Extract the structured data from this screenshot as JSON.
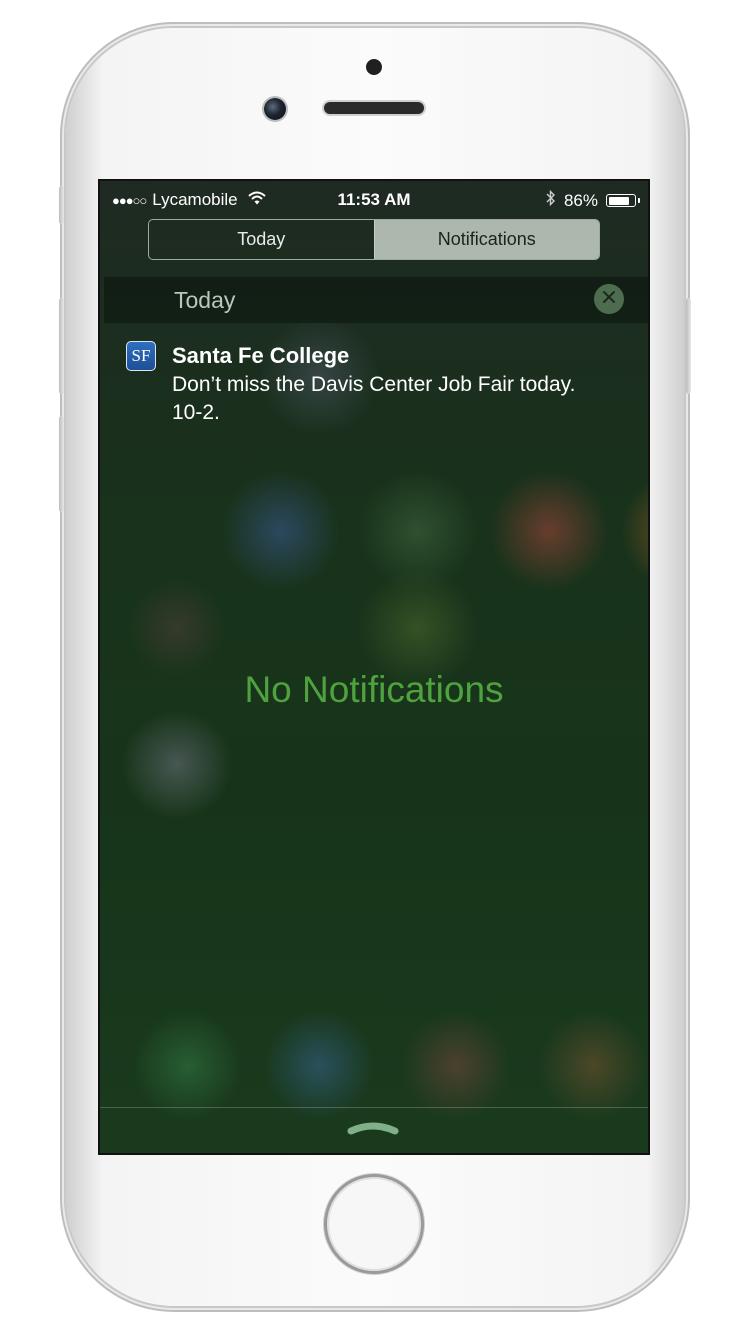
{
  "status_bar": {
    "signal_dots": "●●●○○",
    "carrier": "Lycamobile",
    "time": "11:53 AM",
    "battery_percent": "86%",
    "battery_level": 0.86,
    "icons": [
      "signal-dots-icon",
      "wifi-icon",
      "bluetooth-icon",
      "battery-icon"
    ]
  },
  "tabs": [
    {
      "label": "Today",
      "selected": false
    },
    {
      "label": "Notifications",
      "selected": true
    }
  ],
  "section": {
    "title": "Today",
    "clear_icon": "close-icon"
  },
  "notification": {
    "app_icon_text": "SF",
    "title": "Santa Fe College",
    "body": "Don’t miss the Davis Center Job Fair today. 10-2."
  },
  "empty_state": "No Notifications",
  "colors": {
    "accent_green": "#4fa33e",
    "app_icon_blue": "#2f6fc0"
  }
}
